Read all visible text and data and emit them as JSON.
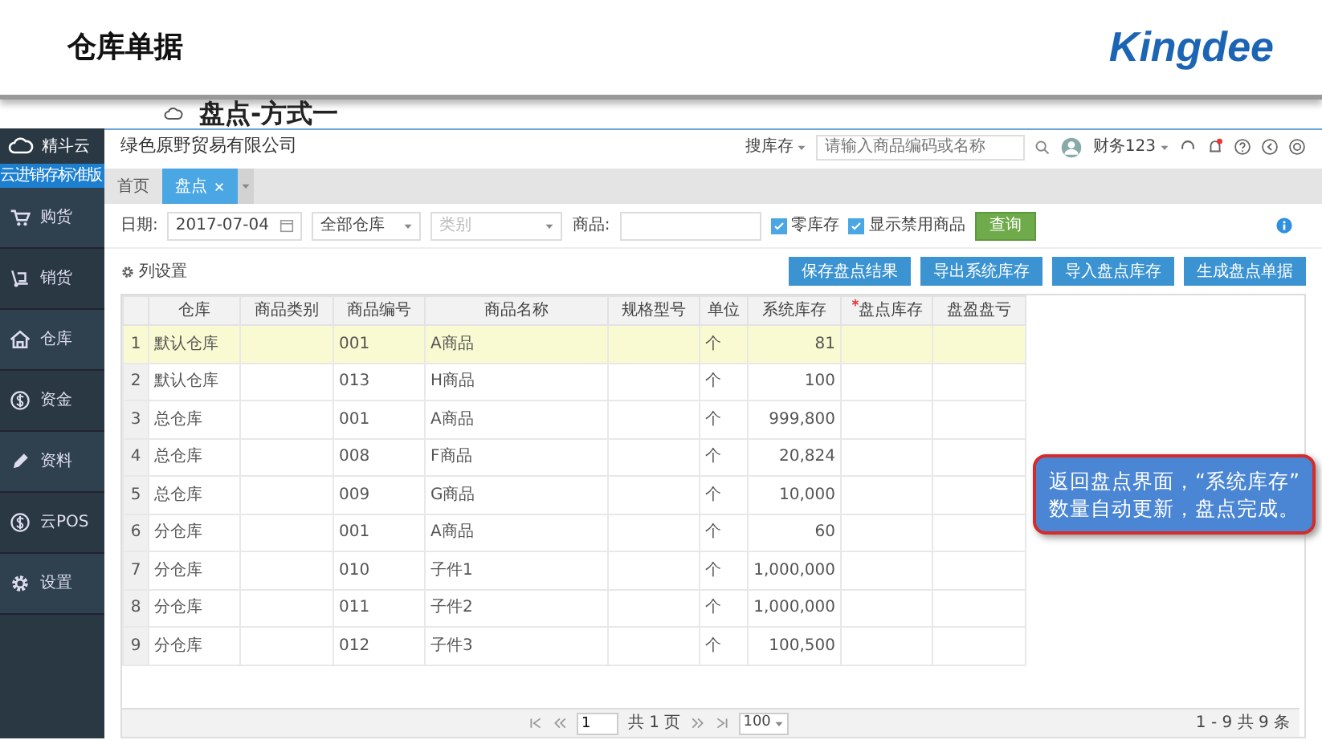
{
  "slide": {
    "title": "仓库单据",
    "logo": "Kingdee",
    "subtitle": "盘点-方式一"
  },
  "sidebar": {
    "brand": "精斗云",
    "edition": "云进销存标准版",
    "items": [
      {
        "label": "购货"
      },
      {
        "label": "销货"
      },
      {
        "label": "仓库"
      },
      {
        "label": "资金"
      },
      {
        "label": "资料"
      },
      {
        "label": "云POS"
      },
      {
        "label": "设置"
      }
    ]
  },
  "topbar": {
    "company": "绿色原野贸易有限公司",
    "search_scope": "搜库存",
    "search_placeholder": "请输入商品编码或名称",
    "user": "财务123"
  },
  "tabs": [
    {
      "label": "首页",
      "selected": false,
      "closable": false
    },
    {
      "label": "盘点",
      "selected": true,
      "closable": true
    }
  ],
  "filters": {
    "date_label": "日期:",
    "date": "2017-07-04",
    "warehouse": "全部仓库",
    "category_placeholder": "类别",
    "product_label": "商品:",
    "checks": [
      {
        "label": "零库存",
        "checked": true
      },
      {
        "label": "显示禁用商品",
        "checked": true
      }
    ],
    "query": "查询"
  },
  "toolbar": {
    "column_settings": "列设置",
    "buttons": [
      "保存盘点结果",
      "导出系统库存",
      "导入盘点库存",
      "生成盘点单据"
    ]
  },
  "table": {
    "columns": [
      {
        "label": "仓库",
        "required": false
      },
      {
        "label": "商品类别",
        "required": false
      },
      {
        "label": "商品编号",
        "required": false
      },
      {
        "label": "商品名称",
        "required": false
      },
      {
        "label": "规格型号",
        "required": false
      },
      {
        "label": "单位",
        "required": false
      },
      {
        "label": "系统库存",
        "required": false
      },
      {
        "label": "盘点库存",
        "required": true
      },
      {
        "label": "盘盈盘亏",
        "required": false
      }
    ],
    "rows": [
      {
        "no": "1",
        "selected": true,
        "cells": [
          "默认仓库",
          "",
          "001",
          "A商品",
          "",
          "个",
          "81",
          "",
          ""
        ]
      },
      {
        "no": "2",
        "selected": false,
        "cells": [
          "默认仓库",
          "",
          "013",
          "H商品",
          "",
          "个",
          "100",
          "",
          ""
        ]
      },
      {
        "no": "3",
        "selected": false,
        "cells": [
          "总仓库",
          "",
          "001",
          "A商品",
          "",
          "个",
          "999,800",
          "",
          ""
        ]
      },
      {
        "no": "4",
        "selected": false,
        "cells": [
          "总仓库",
          "",
          "008",
          "F商品",
          "",
          "个",
          "20,824",
          "",
          ""
        ]
      },
      {
        "no": "5",
        "selected": false,
        "cells": [
          "总仓库",
          "",
          "009",
          "G商品",
          "",
          "个",
          "10,000",
          "",
          ""
        ]
      },
      {
        "no": "6",
        "selected": false,
        "cells": [
          "分仓库",
          "",
          "001",
          "A商品",
          "",
          "个",
          "60",
          "",
          ""
        ]
      },
      {
        "no": "7",
        "selected": false,
        "cells": [
          "分仓库",
          "",
          "010",
          "子件1",
          "",
          "个",
          "1,000,000",
          "",
          ""
        ]
      },
      {
        "no": "8",
        "selected": false,
        "cells": [
          "分仓库",
          "",
          "011",
          "子件2",
          "",
          "个",
          "1,000,000",
          "",
          ""
        ]
      },
      {
        "no": "9",
        "selected": false,
        "cells": [
          "分仓库",
          "",
          "012",
          "子件3",
          "",
          "个",
          "100,500",
          "",
          ""
        ]
      }
    ]
  },
  "pager": {
    "page": "1",
    "pages": "共 1 页",
    "page_size": "100",
    "summary": "1 - 9  共 9 条"
  },
  "callout": {
    "lines": [
      "返回盘点界面，“系统库存”",
      "数量自动更新，盘点完成。"
    ]
  }
}
